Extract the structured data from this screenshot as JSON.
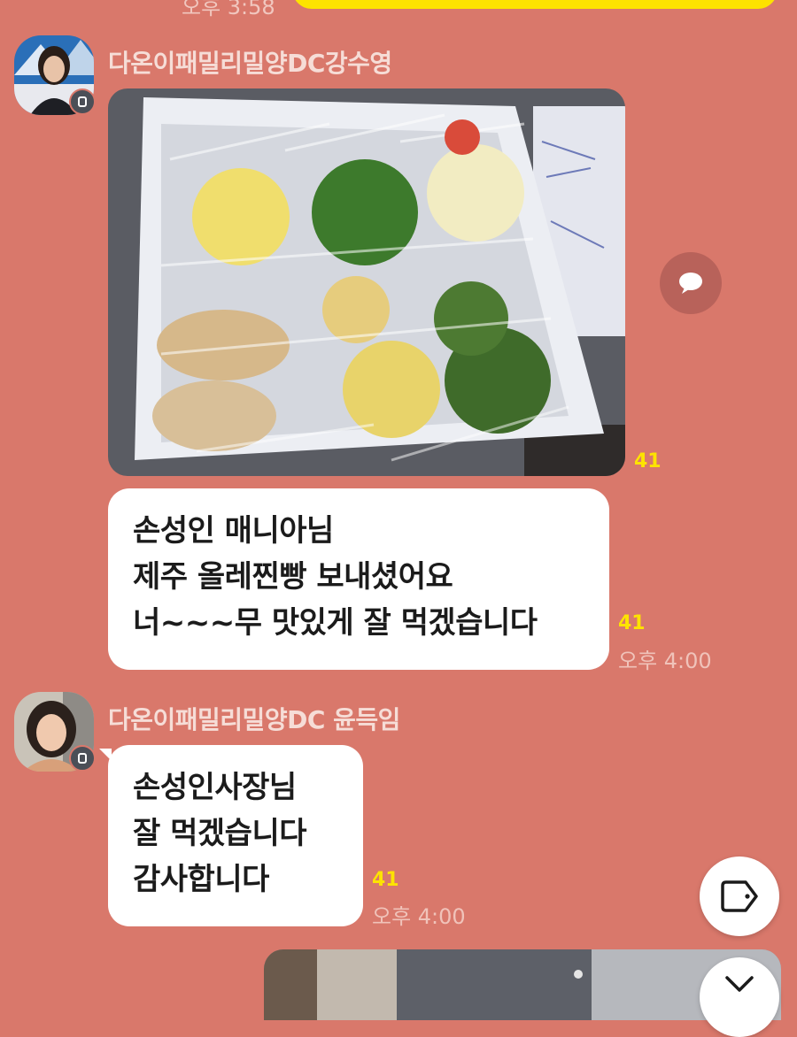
{
  "top": {
    "time": "오후 3:58"
  },
  "messages": [
    {
      "sender": "다온이패밀리밀양DC강수영",
      "photo_read_count": "41",
      "text_lines": [
        "손성인 매니아님",
        "제주 올레찐빵 보내셨어요",
        "너~~~무 맛있게 잘 먹겠습니다"
      ],
      "read_count": "41",
      "time": "오후 4:00"
    },
    {
      "sender": "다온이패밀리밀양DC 윤득임",
      "text_lines": [
        "손성인사장님",
        "잘 먹겠습니다",
        "감사합니다"
      ],
      "read_count": "41",
      "time": "오후 4:00"
    }
  ],
  "icons": {
    "share": "speech-bubble-icon",
    "tag": "tag-icon",
    "scroll_down": "chevron-down-icon",
    "profile_badge": "profile-badge-icon"
  },
  "colors": {
    "background": "#d9786b",
    "my_bubble": "#fde300",
    "other_bubble": "#ffffff",
    "read_count": "#fde300"
  }
}
